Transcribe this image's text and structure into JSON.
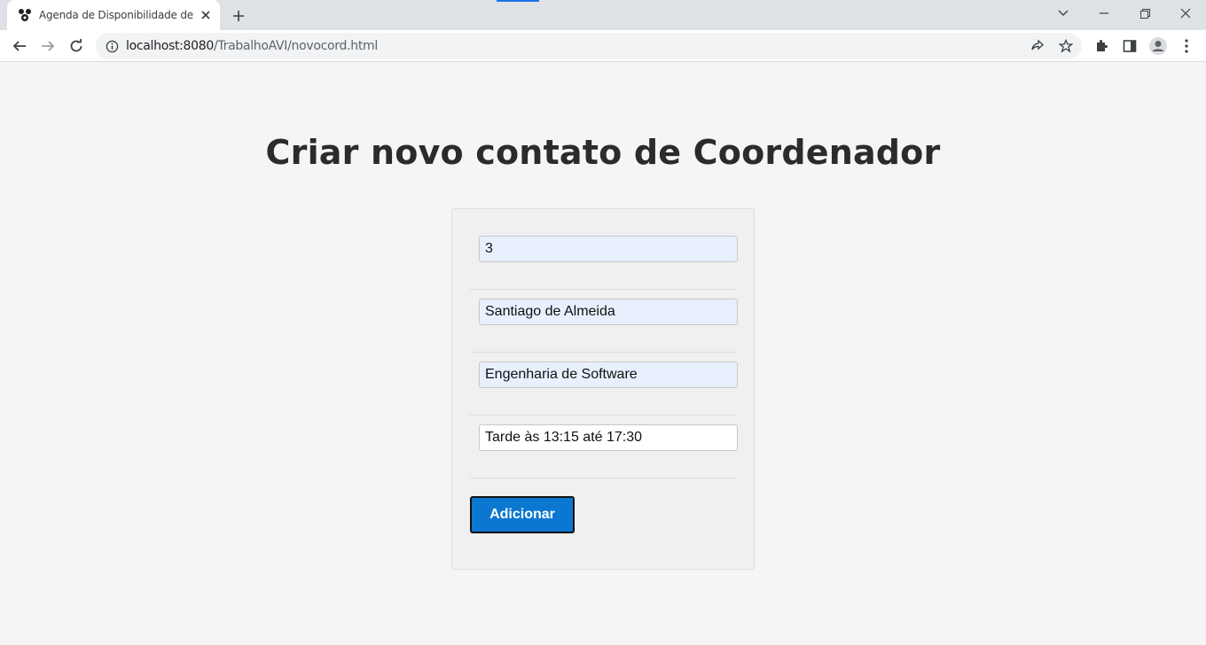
{
  "browser": {
    "tab_title": "Agenda de Disponibilidade de Coordenadores",
    "url_host": "localhost:8080",
    "url_path": "/TrabalhoAVI/novocord.html",
    "icons": {
      "favicon": "app-favicon",
      "tab_close": "close-icon",
      "new_tab": "plus-icon",
      "tab_search": "chevron-down-icon",
      "minimize": "minimize-icon",
      "restore": "restore-icon",
      "close_window": "close-icon",
      "back": "arrow-left-icon",
      "forward": "arrow-right-icon",
      "reload": "reload-icon",
      "site_info": "info-icon",
      "share": "share-icon",
      "bookmark": "star-icon",
      "extensions": "puzzle-icon",
      "side_panel": "side-panel-icon",
      "profile": "profile-icon",
      "menu": "kebab-menu-icon"
    }
  },
  "page": {
    "title": "Criar novo contato de Coordenador",
    "form": {
      "id_value": "3",
      "name_value": "Santiago de Almeida",
      "course_value": "Engenharia de Software",
      "schedule_value": "Tarde às 13:15 até 17:30",
      "submit_label": "Adicionar"
    }
  },
  "colors": {
    "button_bg": "#0b77d1",
    "autofill_bg": "#e8f0fe",
    "card_bg": "#f0f0f0",
    "page_bg": "#f5f5f5"
  }
}
